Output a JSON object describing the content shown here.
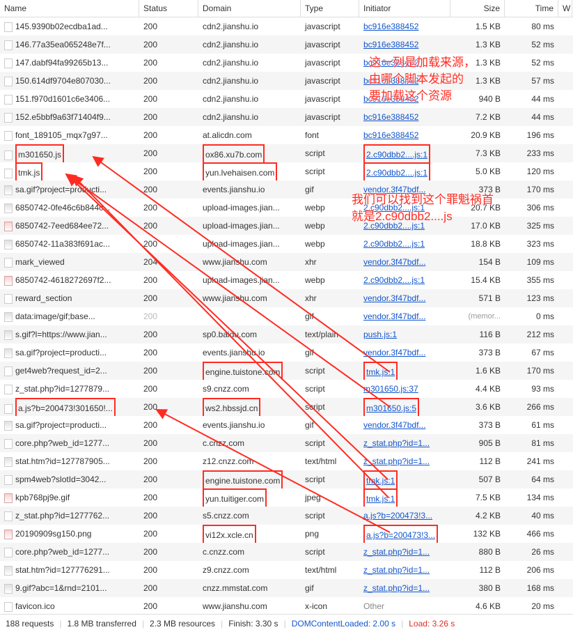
{
  "headers": {
    "name": "Name",
    "status": "Status",
    "domain": "Domain",
    "type": "Type",
    "initiator": "Initiator",
    "size": "Size",
    "time": "Time",
    "w": "W"
  },
  "rows": [
    {
      "name": "145.9390b02ecdba1ad...",
      "status": "200",
      "domain": "cdn2.jianshu.io",
      "type": "javascript",
      "initiator": "bc916e388452",
      "size": "1.5 KB",
      "time": "80 ms",
      "icon": "doc",
      "hl": {}
    },
    {
      "name": "146.77a35ea065248e7f...",
      "status": "200",
      "domain": "cdn2.jianshu.io",
      "type": "javascript",
      "initiator": "bc916e388452",
      "size": "1.3 KB",
      "time": "52 ms",
      "icon": "doc",
      "hl": {}
    },
    {
      "name": "147.dabf94fa99265b13...",
      "status": "200",
      "domain": "cdn2.jianshu.io",
      "type": "javascript",
      "initiator": "bc916e388452",
      "size": "1.3 KB",
      "time": "52 ms",
      "icon": "doc",
      "hl": {}
    },
    {
      "name": "150.614df9704e807030...",
      "status": "200",
      "domain": "cdn2.jianshu.io",
      "type": "javascript",
      "initiator": "bc916e388452",
      "size": "1.3 KB",
      "time": "57 ms",
      "icon": "doc",
      "hl": {}
    },
    {
      "name": "151.f970d1601c6e3406...",
      "status": "200",
      "domain": "cdn2.jianshu.io",
      "type": "javascript",
      "initiator": "bc916e388452",
      "size": "940 B",
      "time": "44 ms",
      "icon": "doc",
      "hl": {}
    },
    {
      "name": "152.e5bbf9a63f71404f9...",
      "status": "200",
      "domain": "cdn2.jianshu.io",
      "type": "javascript",
      "initiator": "bc916e388452",
      "size": "7.2 KB",
      "time": "44 ms",
      "icon": "doc",
      "hl": {}
    },
    {
      "name": "font_189105_mqx7g97...",
      "status": "200",
      "domain": "at.alicdn.com",
      "type": "font",
      "initiator": "bc916e388452",
      "size": "20.9 KB",
      "time": "196 ms",
      "icon": "doc",
      "hl": {}
    },
    {
      "name": "m301650.js",
      "status": "200",
      "domain": "ox86.xu7b.com",
      "type": "script",
      "initiator": "2.c90dbb2....js:1",
      "size": "7.3 KB",
      "time": "233 ms",
      "icon": "doc",
      "hl": {
        "name": true,
        "domain": true,
        "initiator": true
      }
    },
    {
      "name": "tmk.js",
      "status": "200",
      "domain": "yun.lvehaisen.com",
      "type": "script",
      "initiator": "2.c90dbb2....js:1",
      "size": "5.0 KB",
      "time": "120 ms",
      "icon": "doc",
      "hl": {
        "name": true,
        "domain": true,
        "initiator": true
      }
    },
    {
      "name": "sa.gif?project=producti...",
      "status": "200",
      "domain": "events.jianshu.io",
      "type": "gif",
      "initiator": "vendor.3f47bdf...",
      "size": "373 B",
      "time": "170 ms",
      "icon": "img",
      "hl": {}
    },
    {
      "name": "6850742-0fe46c6b844c...",
      "status": "200",
      "domain": "upload-images.jian...",
      "type": "webp",
      "initiator": "2.c90dbb2....js:1",
      "size": "20.7 KB",
      "time": "306 ms",
      "icon": "img",
      "hl": {}
    },
    {
      "name": "6850742-7eed684ee72...",
      "status": "200",
      "domain": "upload-images.jian...",
      "type": "webp",
      "initiator": "2.c90dbb2....js:1",
      "size": "17.0 KB",
      "time": "325 ms",
      "icon": "img-red",
      "hl": {}
    },
    {
      "name": "6850742-11a383f691ac...",
      "status": "200",
      "domain": "upload-images.jian...",
      "type": "webp",
      "initiator": "2.c90dbb2....js:1",
      "size": "18.8 KB",
      "time": "323 ms",
      "icon": "img",
      "hl": {}
    },
    {
      "name": "mark_viewed",
      "status": "204",
      "domain": "www.jianshu.com",
      "type": "xhr",
      "initiator": "vendor.3f47bdf...",
      "size": "154 B",
      "time": "109 ms",
      "icon": "doc",
      "hl": {}
    },
    {
      "name": "6850742-4618272697f2...",
      "status": "200",
      "domain": "upload-images.jian...",
      "type": "webp",
      "initiator": "2.c90dbb2....js:1",
      "size": "15.4 KB",
      "time": "355 ms",
      "icon": "img-red",
      "hl": {}
    },
    {
      "name": "reward_section",
      "status": "200",
      "domain": "www.jianshu.com",
      "type": "xhr",
      "initiator": "vendor.3f47bdf...",
      "size": "571 B",
      "time": "123 ms",
      "icon": "doc",
      "hl": {}
    },
    {
      "name": "data:image/gif;base...",
      "status": "200",
      "domain": "",
      "type": "gif",
      "initiator": "vendor.3f47bdf...",
      "size": "(memor...",
      "time": "0 ms",
      "icon": "img",
      "hl": {},
      "dim": true,
      "mem": true
    },
    {
      "name": "s.gif?l=https://www.jian...",
      "status": "200",
      "domain": "sp0.baidu.com",
      "type": "text/plain",
      "initiator": "push.js:1",
      "size": "116 B",
      "time": "212 ms",
      "icon": "img",
      "hl": {}
    },
    {
      "name": "sa.gif?project=producti...",
      "status": "200",
      "domain": "events.jianshu.io",
      "type": "gif",
      "initiator": "vendor.3f47bdf...",
      "size": "373 B",
      "time": "67 ms",
      "icon": "img",
      "hl": {}
    },
    {
      "name": "get4web?request_id=2...",
      "status": "200",
      "domain": "engine.tuistone.com",
      "type": "script",
      "initiator": "tmk.js:1",
      "size": "1.6 KB",
      "time": "170 ms",
      "icon": "doc",
      "hl": {
        "domain": true,
        "initiator": true
      }
    },
    {
      "name": "z_stat.php?id=1277879...",
      "status": "200",
      "domain": "s9.cnzz.com",
      "type": "script",
      "initiator": "m301650.js:37",
      "size": "4.4 KB",
      "time": "93 ms",
      "icon": "doc",
      "hl": {}
    },
    {
      "name": "a.js?b=200473!301650!...",
      "status": "200",
      "domain": "ws2.hbssjd.cn",
      "type": "script",
      "initiator": "m301650.js:5",
      "size": "3.6 KB",
      "time": "266 ms",
      "icon": "doc",
      "hl": {
        "name": true,
        "domain": true,
        "initiator": true
      }
    },
    {
      "name": "sa.gif?project=producti...",
      "status": "200",
      "domain": "events.jianshu.io",
      "type": "gif",
      "initiator": "vendor.3f47bdf...",
      "size": "373 B",
      "time": "61 ms",
      "icon": "img",
      "hl": {}
    },
    {
      "name": "core.php?web_id=1277...",
      "status": "200",
      "domain": "c.cnzz.com",
      "type": "script",
      "initiator": "z_stat.php?id=1...",
      "size": "905 B",
      "time": "81 ms",
      "icon": "doc",
      "hl": {}
    },
    {
      "name": "stat.htm?id=127787905...",
      "status": "200",
      "domain": "z12.cnzz.com",
      "type": "text/html",
      "initiator": "z_stat.php?id=1...",
      "size": "112 B",
      "time": "241 ms",
      "icon": "img",
      "hl": {}
    },
    {
      "name": "spm4web?slotId=3042...",
      "status": "200",
      "domain": "engine.tuistone.com",
      "type": "script",
      "initiator": "tmk.js:1",
      "size": "507 B",
      "time": "64 ms",
      "icon": "doc",
      "hl": {
        "domain": true,
        "initiator": true
      }
    },
    {
      "name": "kpb768pj9e.gif",
      "status": "200",
      "domain": "yun.tuitiger.com",
      "type": "jpeg",
      "initiator": "tmk.js:1",
      "size": "7.5 KB",
      "time": "134 ms",
      "icon": "img-red",
      "hl": {
        "domain": true,
        "initiator": true
      }
    },
    {
      "name": "z_stat.php?id=1277762...",
      "status": "200",
      "domain": "s5.cnzz.com",
      "type": "script",
      "initiator": "a.js?b=200473!3...",
      "size": "4.2 KB",
      "time": "40 ms",
      "icon": "doc",
      "hl": {}
    },
    {
      "name": "20190909sg150.png",
      "status": "200",
      "domain": "vi12x.xcle.cn",
      "type": "png",
      "initiator": "a.js?b=200473!3...",
      "size": "132 KB",
      "time": "466 ms",
      "icon": "img-red",
      "hl": {
        "domain": true,
        "initiator": true
      }
    },
    {
      "name": "core.php?web_id=1277...",
      "status": "200",
      "domain": "c.cnzz.com",
      "type": "script",
      "initiator": "z_stat.php?id=1...",
      "size": "880 B",
      "time": "26 ms",
      "icon": "doc",
      "hl": {}
    },
    {
      "name": "stat.htm?id=127776291...",
      "status": "200",
      "domain": "z9.cnzz.com",
      "type": "text/html",
      "initiator": "z_stat.php?id=1...",
      "size": "112 B",
      "time": "206 ms",
      "icon": "img",
      "hl": {}
    },
    {
      "name": "9.gif?abc=1&rnd=2101...",
      "status": "200",
      "domain": "cnzz.mmstat.com",
      "type": "gif",
      "initiator": "z_stat.php?id=1...",
      "size": "380 B",
      "time": "168 ms",
      "icon": "img",
      "hl": {}
    },
    {
      "name": "favicon.ico",
      "status": "200",
      "domain": "www.jianshu.com",
      "type": "x-icon",
      "initiator": "Other",
      "size": "4.6 KB",
      "time": "20 ms",
      "icon": "doc",
      "hl": {},
      "other": true
    }
  ],
  "footer": {
    "requests": "188 requests",
    "transferred": "1.8 MB transferred",
    "resources": "2.3 MB resources",
    "finish": "Finish: 3.30 s",
    "dcl": "DOMContentLoaded: 2.00 s",
    "load": "Load: 3.26 s"
  },
  "annotations": {
    "a1_line1": "这一列是加载来源，",
    "a1_line2": "由哪个脚本发起的",
    "a1_line3": "要加载这个资源",
    "a2_line1": "我们可以找到这个罪魁祸首",
    "a2_line2": "就是2.c90dbb2....js"
  }
}
